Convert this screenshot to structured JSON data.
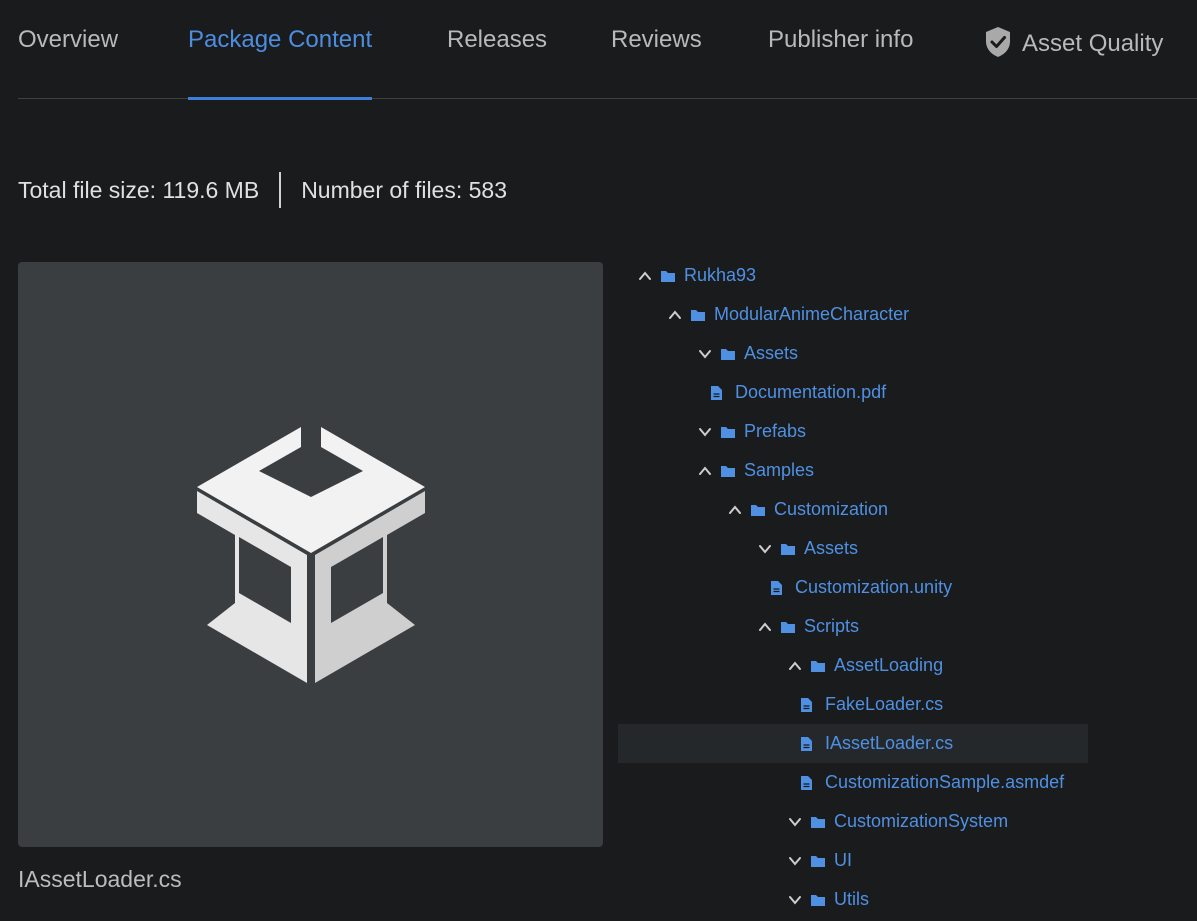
{
  "tabs": [
    {
      "label": "Overview"
    },
    {
      "label": "Package Content"
    },
    {
      "label": "Releases"
    },
    {
      "label": "Reviews"
    },
    {
      "label": "Publisher info"
    },
    {
      "label": "Asset Quality",
      "icon": "shield-check-icon"
    }
  ],
  "active_tab": "Package Content",
  "summary": {
    "total_size": "Total file size: 119.6 MB",
    "file_count": "Number of files: 583"
  },
  "preview": {
    "icon": "unity-logo-icon",
    "caption": "IAssetLoader.cs"
  },
  "tree": [
    {
      "label": "Rukha93",
      "type": "folder",
      "state": "expanded"
    },
    {
      "label": "ModularAnimeCharacter",
      "type": "folder",
      "state": "expanded"
    },
    {
      "label": "Assets",
      "type": "folder",
      "state": "collapsed"
    },
    {
      "label": "Documentation.pdf",
      "type": "file"
    },
    {
      "label": "Prefabs",
      "type": "folder",
      "state": "collapsed"
    },
    {
      "label": "Samples",
      "type": "folder",
      "state": "expanded"
    },
    {
      "label": "Customization",
      "type": "folder",
      "state": "expanded"
    },
    {
      "label": "Assets",
      "type": "folder",
      "state": "collapsed"
    },
    {
      "label": "Customization.unity",
      "type": "file"
    },
    {
      "label": "Scripts",
      "type": "folder",
      "state": "expanded"
    },
    {
      "label": "AssetLoading",
      "type": "folder",
      "state": "expanded"
    },
    {
      "label": "FakeLoader.cs",
      "type": "file"
    },
    {
      "label": "IAssetLoader.cs",
      "type": "file",
      "selected": true
    },
    {
      "label": "CustomizationSample.asmdef",
      "type": "file"
    },
    {
      "label": "CustomizationSystem",
      "type": "folder",
      "state": "collapsed"
    },
    {
      "label": "UI",
      "type": "folder",
      "state": "collapsed"
    },
    {
      "label": "Utils",
      "type": "folder",
      "state": "collapsed"
    }
  ],
  "colors": {
    "background": "#1a1b1d",
    "accent": "#4c8de0",
    "tree_link": "#4f90e2",
    "preview_bg": "#3a3e41",
    "selected_row": "#25282b"
  }
}
